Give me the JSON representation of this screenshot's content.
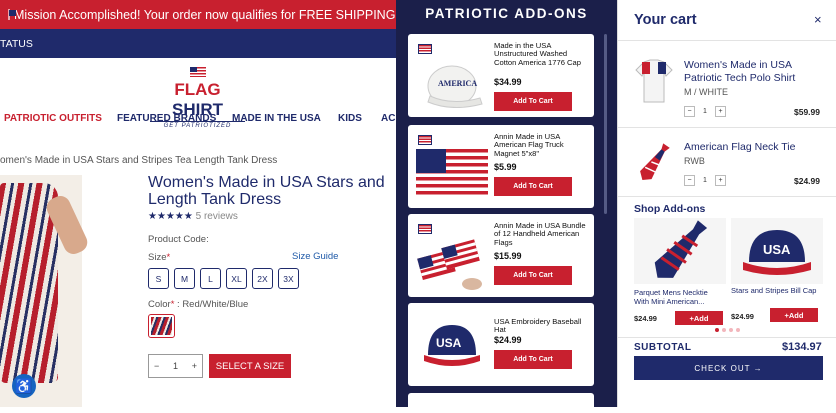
{
  "banner": {
    "text": "Mission Accomplished! Your order now qualifies for FREE SHIPPING!"
  },
  "status": {
    "text": "TATUS"
  },
  "logo": {
    "word1": "FLAG ",
    "word2": "SHIRT",
    "tagline": "GET PATRIOTIZED"
  },
  "nav": {
    "items": [
      "PATRIOTIC OUTFITS",
      "FEATURED BRANDS",
      "MADE IN THE USA",
      "KIDS",
      "AC"
    ]
  },
  "breadcrumb": "omen's Made in USA Stars and Stripes Tea Length Tank Dress",
  "product": {
    "title": "Women's Made in USA Stars and Length Tank Dress",
    "stars": "★★★★★",
    "reviews": "5 reviews",
    "product_code_label": "Product Code:",
    "size_label": "Size",
    "size_guide": "Size Guide",
    "sizes": [
      "S",
      "M",
      "L",
      "XL",
      "2X",
      "3X"
    ],
    "color_label": "Color",
    "color_value": " : Red/White/Blue",
    "quantity": "1",
    "minus": "−",
    "plus": "+",
    "select_button": "SELECT A SIZE"
  },
  "addons": {
    "title": "PATRIOTIC ADD-ONS",
    "items": [
      {
        "name": "Made in the USA Unstructured Washed Cotton America 1776 Cap",
        "price": "$34.99",
        "button": "Add To Cart"
      },
      {
        "name": "Annin Made in USA American Flag Truck Magnet 5\"x8\"",
        "price": "$5.99",
        "button": "Add To Cart"
      },
      {
        "name": "Annin Made in USA Bundle of 12 Handheld American Flags",
        "price": "$15.99",
        "button": "Add To Cart"
      },
      {
        "name": "USA Embroidery Baseball Hat",
        "price": "$24.99",
        "button": "Add To Cart"
      }
    ]
  },
  "cart": {
    "title": "Your cart",
    "close": "×",
    "items": [
      {
        "name": "Women's Made in USA Patriotic Tech Polo Shirt",
        "variant": "M / WHITE",
        "qty": "1",
        "price": "$59.99"
      },
      {
        "name": "American Flag Neck Tie",
        "variant": "RWB",
        "qty": "1",
        "price": "$24.99"
      }
    ],
    "shop_addons_title": "Shop Add-ons",
    "shop_addons": [
      {
        "name": "Parquet Mens Necktie With Mini American...",
        "price": "$24.99",
        "button": "+Add"
      },
      {
        "name": "Stars and Stripes Bill Cap",
        "price": "$24.99",
        "button": "+Add"
      }
    ],
    "subtotal_label": "SUBTOTAL",
    "subtotal_value": "$134.97",
    "checkout": "CHECK OUT →"
  },
  "colors": {
    "red": "#c8202f",
    "navy": "#1f2a6b",
    "addons_bg": "#1b1f4a"
  }
}
